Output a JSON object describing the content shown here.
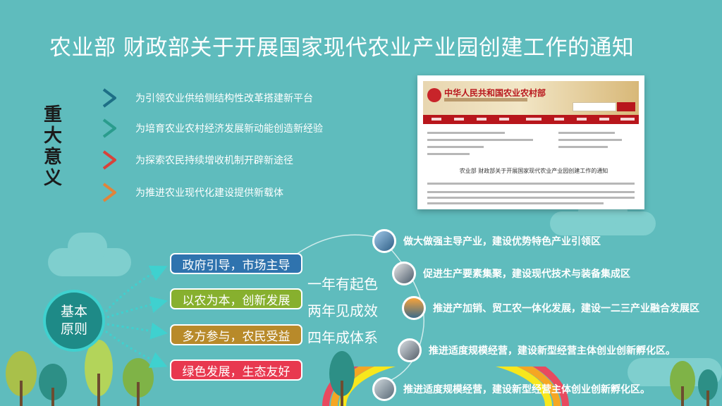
{
  "title": "农业部 财政部关于开展国家现代农业产业园创建工作的通知",
  "significance": {
    "heading_chars": [
      "重",
      "大",
      "意",
      "义"
    ],
    "items": [
      {
        "text": "为引领农业供给侧结构性改革搭建新平台",
        "color": "#1d6f86"
      },
      {
        "text": "为培育农业农村经济发展新动能创造新经验",
        "color": "#2a9c8d"
      },
      {
        "text": "为探索农民持续增收机制开辟新途径",
        "color": "#d8423a"
      },
      {
        "text": "为推进农业现代化建设提供新载体",
        "color": "#e0843a"
      }
    ]
  },
  "document_screenshot": {
    "site_name": "中华人民共和国农业农村部",
    "doc_title": "农业部 财政部关于开展国家现代农业产业园创建工作的通知"
  },
  "principles": {
    "hub_lines": [
      "基本",
      "原则"
    ],
    "items": [
      {
        "text": "政府引导，市场主导",
        "color": "#2f73ae"
      },
      {
        "text": "以农为本，创新发展",
        "color": "#87b02e"
      },
      {
        "text": "多方参与，农民受益",
        "color": "#b88a2a"
      },
      {
        "text": "绿色发展，生态友好",
        "color": "#e8384f"
      }
    ]
  },
  "timeline": [
    "一年有起色",
    "两年见成效",
    "四年成体系"
  ],
  "zones": [
    "做大做强主导产业，建设优势特色产业引领区",
    "促进生产要素集聚，建设现代技术与装备集成区",
    "推进产加销、贸工农一体化发展，建设一二三产业融合发展区",
    "推进适度规模经营，建设新型经营主体创业创新孵化区。",
    "推进适度规模经营，建设新型经营主体创业创新孵化区。"
  ]
}
